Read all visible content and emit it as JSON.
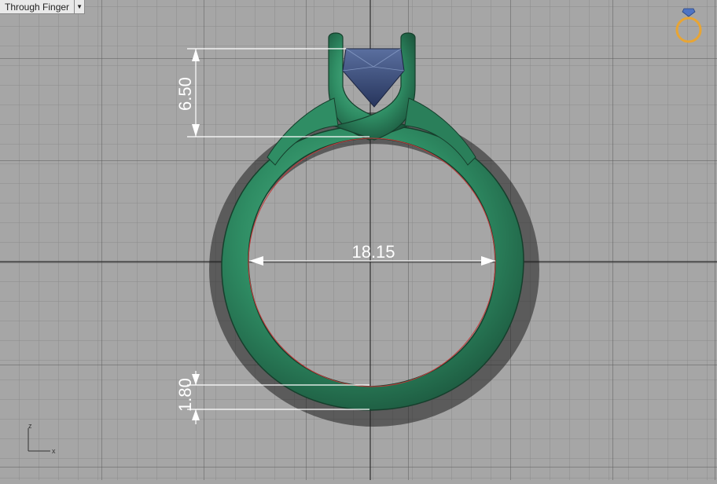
{
  "viewport": {
    "label": "Through Finger",
    "dropdown_icon": "triangle-down-icon"
  },
  "dimensions": {
    "prong_height": "6.50",
    "inner_diameter": "18.15",
    "shank_thickness": "1.80"
  },
  "axes": {
    "x": "x",
    "z": "z"
  },
  "colors": {
    "background": "#a6a6a6",
    "grid_minor": "#8c8c8c",
    "grid_major": "#3d3d3d",
    "ring_metal": "#2e8a62",
    "gem": "#3b4f7a",
    "dimension_lines": "#ffffff",
    "finger_circle": "#c23a3a",
    "gumball_ring": "#e8a534"
  },
  "icons": {
    "view_cube": "ring-navigation-icon"
  }
}
